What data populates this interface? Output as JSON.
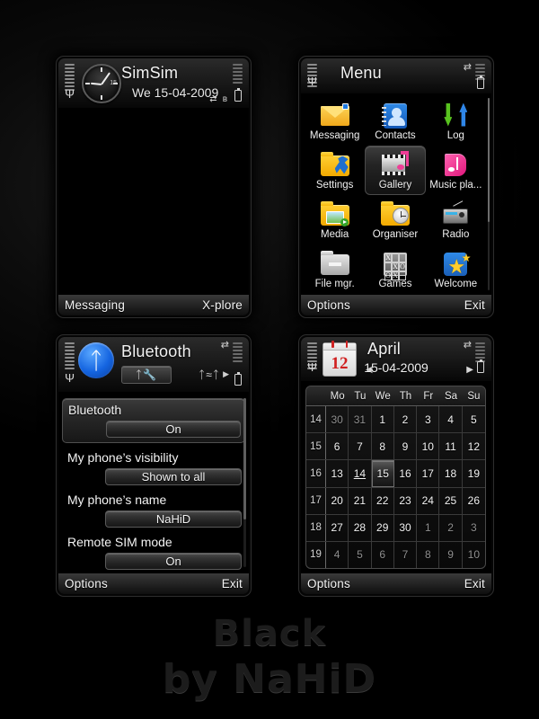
{
  "theme": {
    "name": "Black",
    "author_line": "by NaHiD",
    "accent_blue": "#1464e0",
    "accent_yellow": "#f2a900",
    "accent_pink": "#e0177c",
    "accent_red": "#d01f1f"
  },
  "idle_screen": {
    "operator": "SimSim",
    "date": "We 15-04-2009",
    "clock_marker": "15",
    "softkey_left": "Messaging",
    "softkey_right": "X-plore"
  },
  "menu_screen": {
    "title": "Menu",
    "softkey_left": "Options",
    "softkey_right": "Exit",
    "selected_item": "Gallery",
    "items": [
      {
        "label": "Messaging",
        "icon": "envelope-icon"
      },
      {
        "label": "Contacts",
        "icon": "contacts-book-icon"
      },
      {
        "label": "Log",
        "icon": "call-log-arrows-icon"
      },
      {
        "label": "Settings",
        "icon": "settings-wrench-folder-icon"
      },
      {
        "label": "Gallery",
        "icon": "gallery-film-note-icon"
      },
      {
        "label": "Music pla...",
        "icon": "music-player-icon"
      },
      {
        "label": "Media",
        "icon": "media-folder-icon"
      },
      {
        "label": "Organiser",
        "icon": "organiser-clock-folder-icon"
      },
      {
        "label": "Radio",
        "icon": "radio-icon"
      },
      {
        "label": "File mgr.",
        "icon": "file-manager-folder-icon"
      },
      {
        "label": "Games",
        "icon": "games-tictactoe-icon"
      },
      {
        "label": "Welcome",
        "icon": "welcome-star-icon"
      }
    ]
  },
  "bluetooth_screen": {
    "title": "Bluetooth",
    "tab_settings_icon": "bluetooth-settings-icon",
    "tab_devices_icon": "bluetooth-paired-devices-icon",
    "softkey_left": "Options",
    "softkey_right": "Exit",
    "selected_row": "Bluetooth",
    "settings": [
      {
        "label": "Bluetooth",
        "value": "On"
      },
      {
        "label": "My phone’s visibility",
        "value": "Shown to all"
      },
      {
        "label": "My phone’s name",
        "value": "NaHiD"
      },
      {
        "label": "Remote SIM mode",
        "value": "On"
      }
    ]
  },
  "calendar_screen": {
    "title": "April",
    "date": "15-04-2009",
    "icon_day_number": "12",
    "softkey_left": "Options",
    "softkey_right": "Exit",
    "selected_day": "15",
    "today_day": "14",
    "day_headers": [
      "Mo",
      "Tu",
      "We",
      "Th",
      "Fr",
      "Sa",
      "Su"
    ],
    "weeks": [
      {
        "week_no": "14",
        "days": [
          {
            "d": "30",
            "out": true
          },
          {
            "d": "31",
            "out": true
          },
          {
            "d": "1"
          },
          {
            "d": "2"
          },
          {
            "d": "3"
          },
          {
            "d": "4"
          },
          {
            "d": "5"
          }
        ]
      },
      {
        "week_no": "15",
        "days": [
          {
            "d": "6"
          },
          {
            "d": "7"
          },
          {
            "d": "8"
          },
          {
            "d": "9"
          },
          {
            "d": "10"
          },
          {
            "d": "11"
          },
          {
            "d": "12"
          }
        ]
      },
      {
        "week_no": "16",
        "days": [
          {
            "d": "13"
          },
          {
            "d": "14",
            "today": true
          },
          {
            "d": "15",
            "sel": true
          },
          {
            "d": "16"
          },
          {
            "d": "17"
          },
          {
            "d": "18"
          },
          {
            "d": "19"
          }
        ]
      },
      {
        "week_no": "17",
        "days": [
          {
            "d": "20"
          },
          {
            "d": "21"
          },
          {
            "d": "22"
          },
          {
            "d": "23"
          },
          {
            "d": "24"
          },
          {
            "d": "25"
          },
          {
            "d": "26"
          }
        ]
      },
      {
        "week_no": "18",
        "days": [
          {
            "d": "27"
          },
          {
            "d": "28"
          },
          {
            "d": "29"
          },
          {
            "d": "30"
          },
          {
            "d": "1",
            "out": true
          },
          {
            "d": "2",
            "out": true
          },
          {
            "d": "3",
            "out": true
          }
        ]
      },
      {
        "week_no": "19",
        "days": [
          {
            "d": "4",
            "out": true
          },
          {
            "d": "5",
            "out": true
          },
          {
            "d": "6",
            "out": true
          },
          {
            "d": "7",
            "out": true
          },
          {
            "d": "8",
            "out": true
          },
          {
            "d": "9",
            "out": true
          },
          {
            "d": "10",
            "out": true
          }
        ]
      }
    ]
  },
  "status_icons": {
    "signal": "signal-bars-icon",
    "antenna": "antenna-icon",
    "battery": "battery-icon",
    "network": "network-transfer-icon",
    "bluetooth": "bluetooth-small-icon"
  }
}
